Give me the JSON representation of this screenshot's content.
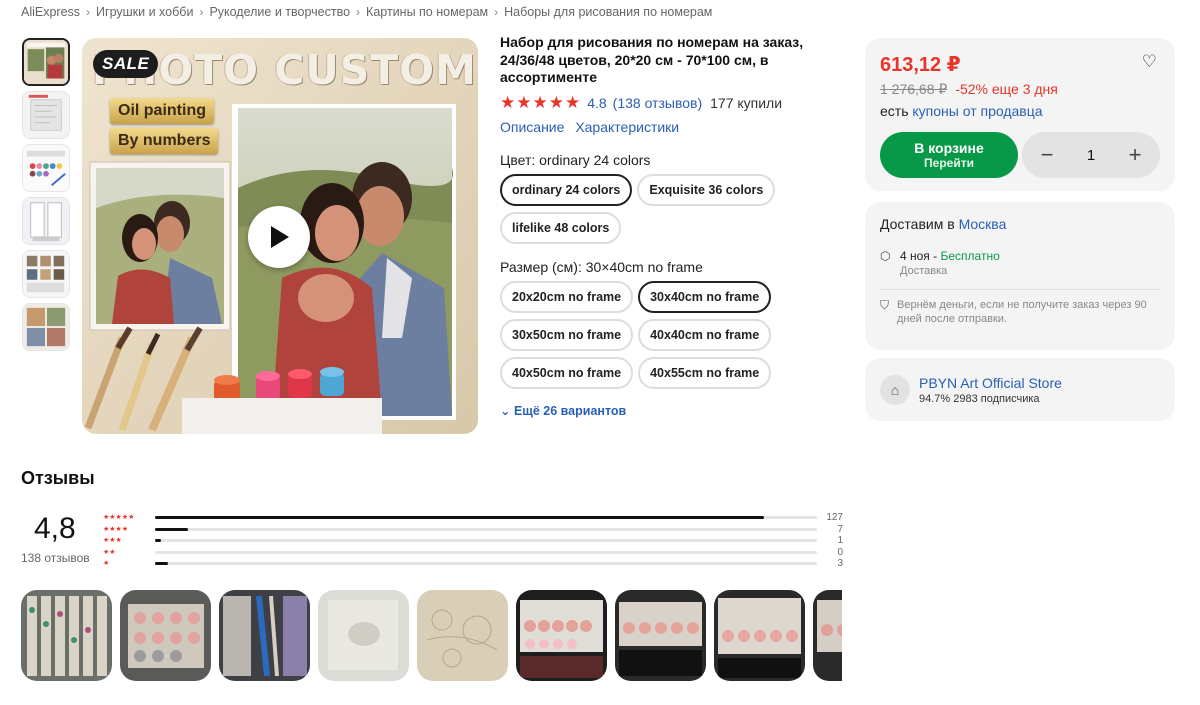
{
  "breadcrumb": [
    "AliExpress",
    "Игрушки и хобби",
    "Рукоделие и творчество",
    "Картины по номерам",
    "Наборы для рисования по номерам"
  ],
  "gallery": {
    "badge": "SALE",
    "headline": "PHOTO CUSTOM",
    "tag1": "Oil painting",
    "tag2": "By numbers",
    "play_icon": "play-icon"
  },
  "product": {
    "title": "Набор для рисования по номерам на заказ, 24/36/48 цветов, 20*20 см - 70*100 см, в ассортименте",
    "stars": "★★★★★",
    "rating": "4.8",
    "reviews_link": "(138 отзывов)",
    "sold": "177 купили",
    "tab_description": "Описание",
    "tab_specs": "Характеристики",
    "color_label": "Цвет: ordinary 24 colors",
    "colors": [
      "ordinary 24 colors",
      "Exquisite 36 colors",
      "lifelike 48 colors"
    ],
    "color_selected_index": 0,
    "size_label": "Размер (см): 30×40cm no frame",
    "sizes": [
      "20x20cm no frame",
      "30x40cm no frame",
      "30x50cm no frame",
      "40x40cm no frame",
      "40x50cm no frame",
      "40x55cm no frame"
    ],
    "size_selected_index": 1,
    "more_variants": "Ещё 26 вариантов"
  },
  "price_card": {
    "price": "613,12 ₽",
    "old_price": "1 276,68 ₽",
    "discount": "-52% еще 3 дня",
    "coupon_prefix": "есть",
    "coupon_link": "купоны от продавца",
    "cart_label": "В корзине",
    "cart_sub": "Перейти",
    "qty_minus": "−",
    "qty_value": "1",
    "qty_plus": "+"
  },
  "delivery": {
    "title_prefix": "Доставим в",
    "city": "Москва",
    "date": "4 ноя",
    "dash": " - ",
    "free": "Бесплатно",
    "sub": "Доставка",
    "refund": "Вернём деньги, если не получите заказ через 90 дней после отправки."
  },
  "store": {
    "name": "PBYN Art Official Store",
    "meta": "94.7%   2983 подписчика"
  },
  "reviews": {
    "heading": "Отзывы",
    "rating": "4,8",
    "count": "138 отзывов",
    "stars_label": "★★★★★",
    "rows": [
      {
        "stars": "★★★★★",
        "count": "127",
        "fraction": 0.92
      },
      {
        "stars": "★★★★",
        "count": "7",
        "fraction": 0.05
      },
      {
        "stars": "★★★",
        "count": "1",
        "fraction": 0.007
      },
      {
        "stars": "★★",
        "count": "0",
        "fraction": 0.0
      },
      {
        "stars": "★",
        "count": "3",
        "fraction": 0.02
      }
    ]
  },
  "colors": {
    "accent_red": "#e8352a",
    "link_blue": "#2a5fb5",
    "cart_green": "#079947"
  }
}
